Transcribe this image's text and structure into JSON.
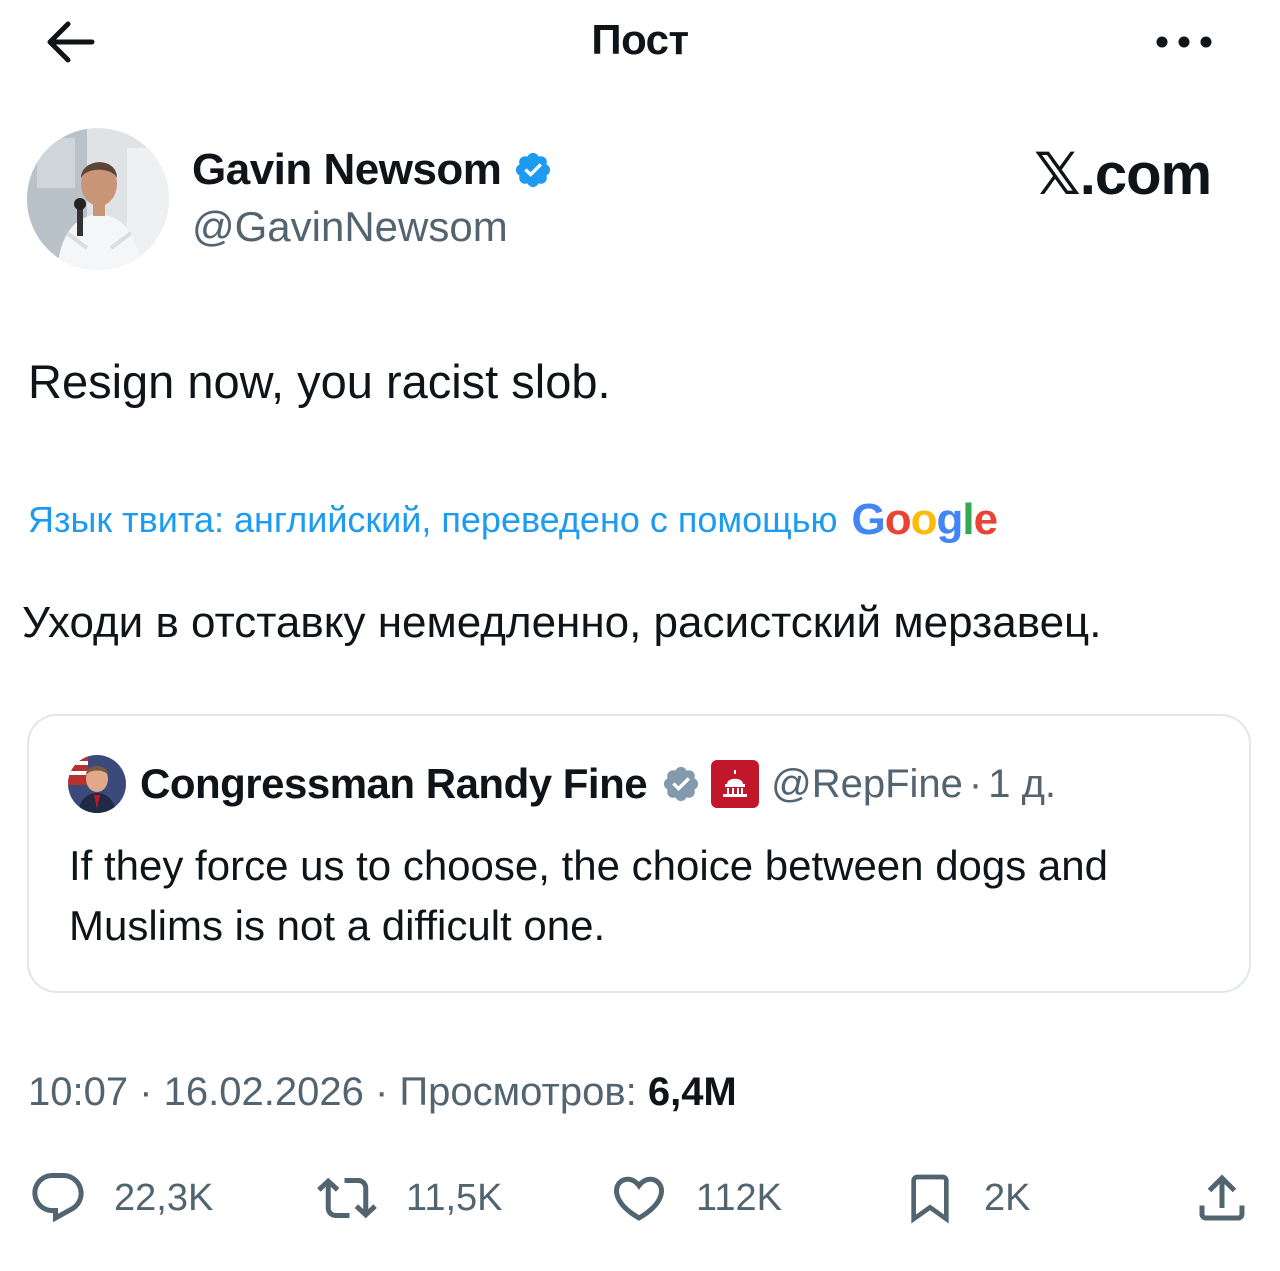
{
  "header": {
    "title": "Пост"
  },
  "author": {
    "name": "Gavin Newsom",
    "handle": "@GavinNewsom",
    "watermark": "𝕏.com"
  },
  "tweet": {
    "text": "Resign now, you racist slob.",
    "translation_note": "Язык твита: английский, переведено с помощью",
    "translation_provider": "Google",
    "translated_text": "Уходи в отставку немедленно, расистский мерзавец."
  },
  "quote": {
    "name": "Congressman Randy Fine",
    "handle": "@RepFine",
    "separator": "·",
    "time": "1 д.",
    "text": "If they force us to choose, the choice between dogs and Muslims is not a difficult one."
  },
  "meta": {
    "time": "10:07",
    "sep": " · ",
    "date": "16.02.2026",
    "views_label": "Просмотров:",
    "views_value": "6,4M"
  },
  "actions": {
    "replies": "22,3K",
    "reposts": "11,5K",
    "likes": "112K",
    "bookmarks": "2K"
  },
  "colors": {
    "text": "#0f1419",
    "secondary": "#536471",
    "link": "#1d9bf0",
    "verified": "#1d9bf0",
    "quote_verified": "#829aab",
    "border": "#e1e6ea"
  },
  "icons": [
    "back-arrow-icon",
    "more-icon",
    "verified-icon",
    "reply-icon",
    "repost-icon",
    "like-icon",
    "bookmark-icon",
    "share-icon"
  ]
}
